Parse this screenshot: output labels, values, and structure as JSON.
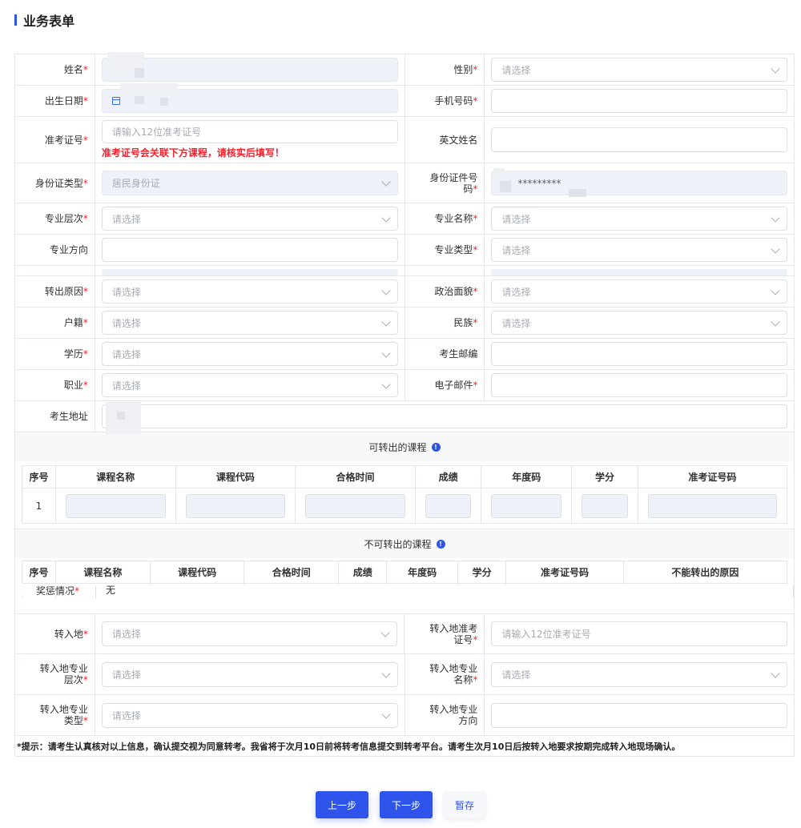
{
  "page": {
    "title": "业务表单"
  },
  "labels": {
    "name": "姓名",
    "gender": "性别",
    "birth": "出生日期",
    "phone": "手机号码",
    "exam_no": "准考证号",
    "english_name": "英文姓名",
    "id_type": "身份证类型",
    "id_no": "身份证件号码",
    "major_level": "专业层次",
    "major_name": "专业名称",
    "major_direction": "专业方向",
    "major_type": "专业类型",
    "out_reason": "转出原因",
    "political": "政治面貌",
    "household": "户籍",
    "nation": "民族",
    "education": "学历",
    "postcode": "考生邮编",
    "job": "职业",
    "email": "电子邮件",
    "address": "考生地址",
    "reward": "奖惩情况",
    "in_place": "转入地",
    "in_exam_no": "转入地准考证号",
    "in_major_level": "转入地专业层次",
    "in_major_name": "转入地专业名称",
    "in_major_type": "转入地专业类型",
    "in_major_direction": "转入地专业方向"
  },
  "required_mark": "*",
  "placeholders": {
    "select": "请选择",
    "exam_no": "请输入12位准考证号"
  },
  "values": {
    "id_type": "居民身份证",
    "id_no_masked": "*********",
    "reward": "无"
  },
  "exam_no_warning": "准考证号会关联下方课程，请核实后填写！",
  "transferable": {
    "title": "可转出的课程",
    "columns": [
      "序号",
      "课程名称",
      "课程代码",
      "合格时间",
      "成绩",
      "年度码",
      "学分",
      "准考证号码"
    ],
    "rows": [
      {
        "index": "1"
      }
    ]
  },
  "non_transferable": {
    "title": "不可转出的课程",
    "columns": [
      "序号",
      "课程名称",
      "课程代码",
      "合格时间",
      "成绩",
      "年度码",
      "学分",
      "准考证号码",
      "不能转出的原因"
    ]
  },
  "tip": "*提示：请考生认真核对以上信息，确认提交视为同意转考。我省将于次月10日前将转考信息提交到转考平台。请考生次月10日后按转入地要求按期完成转入地现场确认。",
  "buttons": {
    "prev": "上一步",
    "next": "下一步",
    "save": "暂存"
  },
  "colors": {
    "accent": "#2f54eb",
    "required": "#f5222d"
  }
}
